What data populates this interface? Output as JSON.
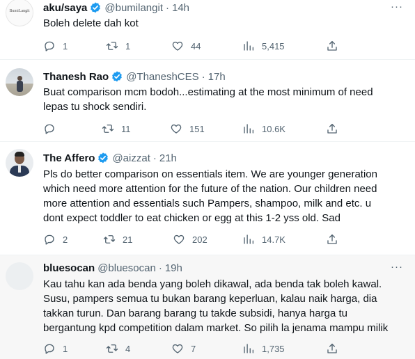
{
  "tweets": [
    {
      "name": "aku/saya",
      "verified": true,
      "handle": "@bumilangit",
      "dot": "·",
      "time": "14h",
      "avatar_text": "BumiLangit",
      "text": "Boleh delete dah kot",
      "replies": "1",
      "retweets": "1",
      "likes": "44",
      "views": "5,415"
    },
    {
      "name": "Thanesh Rao",
      "verified": true,
      "handle": "@ThaneshCES",
      "dot": "·",
      "time": "17h",
      "text": "Buat comparison mcm bodoh...estimating at the most minimum of need\nlepas tu shock sendiri.",
      "replies": "",
      "retweets": "11",
      "likes": "151",
      "views": "10.6K"
    },
    {
      "name": "The Affero",
      "verified": true,
      "handle": "@aizzat",
      "dot": "·",
      "time": "21h",
      "text": "Pls do better comparison on essentials item. We are younger generation\nwhich need more attention for the future of the nation. Our children need\nmore attention and essentials such Pampers, shampoo, milk and etc. u\ndont expect toddler to eat chicken or egg at this 1-2 yss old. Sad",
      "replies": "2",
      "retweets": "21",
      "likes": "202",
      "views": "14.7K"
    },
    {
      "name": "bluesocan",
      "verified": false,
      "handle": "@bluesocan",
      "dot": "·",
      "time": "19h",
      "text": "Kau tahu kan ada benda yang boleh dikawal, ada benda tak boleh kawal.\nSusu, pampers semua tu bukan barang keperluan, kalau naik harga, dia\ntakkan turun. Dan barang barang tu takde subsidi, hanya harga tu\nbergantung kpd competition dalam market. So pilih la jenama mampu milik",
      "replies": "1",
      "retweets": "4",
      "likes": "7",
      "views": "1,735"
    }
  ],
  "colors": {
    "verified": "#1d9bf0",
    "secondary": "#536471",
    "highlight_bg": "#f7f7f7"
  },
  "icons": [
    "reply-icon",
    "retweet-icon",
    "like-icon",
    "views-icon",
    "share-icon",
    "more-icon",
    "verified-icon"
  ]
}
